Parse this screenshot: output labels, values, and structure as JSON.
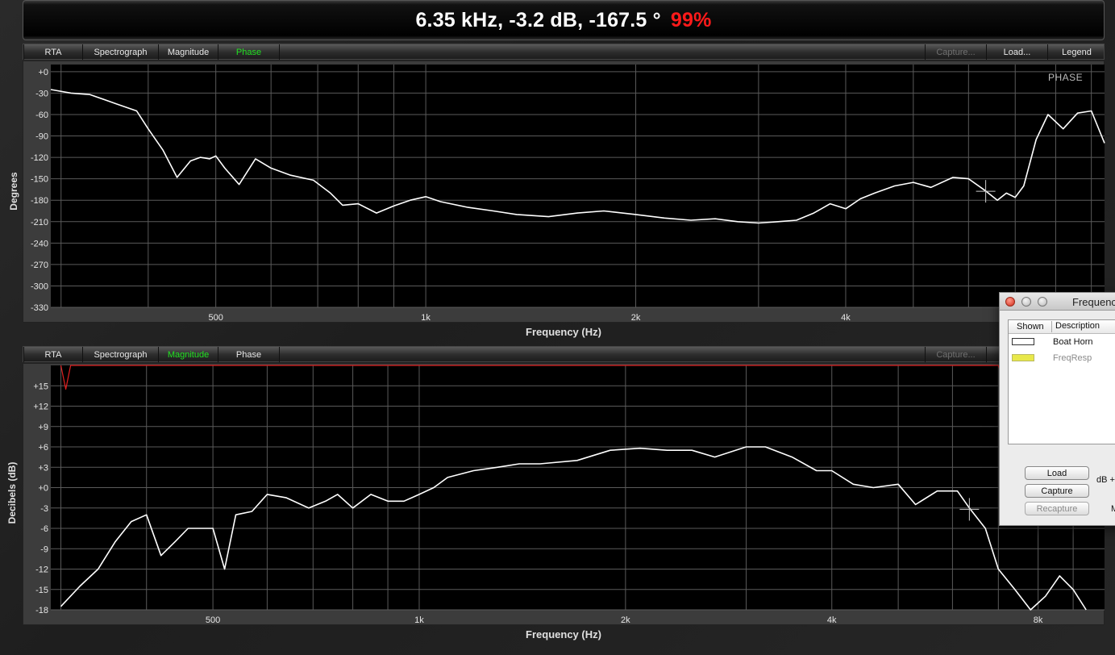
{
  "readout": {
    "text": "6.35 kHz, -3.2 dB, -167.5 °",
    "percent": "99%"
  },
  "tabs_left": [
    "RTA",
    "Spectrograph",
    "Magnitude",
    "Phase"
  ],
  "tabs_right": [
    "Capture...",
    "Load...",
    "Legend"
  ],
  "top_panel": {
    "active_tab": "Phase",
    "corner_label": "PHASE",
    "xlabel": "Frequency (Hz)",
    "ylabel": "Degrees"
  },
  "bottom_panel": {
    "active_tab": "Magnitude",
    "xlabel": "Frequency (Hz)",
    "ylabel": "Decibels (dB)"
  },
  "dialog": {
    "title": "Frequenc",
    "col_shown": "Shown",
    "col_description": "Description",
    "rows": [
      {
        "description": "Boat Horn",
        "swatch": "#ffffff",
        "dimmed": false
      },
      {
        "description": "FreqResp",
        "swatch": "#e8e84a",
        "dimmed": true
      }
    ],
    "load_label": "Load",
    "capture_label": "Capture",
    "recapture_label": "Recapture",
    "side_text_1": "dB +",
    "side_text_2": "M"
  },
  "colors": {
    "trace": "#ffffff",
    "reference": "#e02020",
    "active_tab": "#22e022",
    "percent": "#ff1a1a"
  },
  "chart_data": [
    {
      "type": "line",
      "title": "PHASE",
      "xlabel": "Frequency (Hz)",
      "ylabel": "Degrees",
      "xscale": "log",
      "xlim": [
        290,
        9400
      ],
      "ylim": [
        -330,
        10
      ],
      "x_ticks": [
        500,
        1000,
        2000,
        4000
      ],
      "x_tick_labels": [
        "500",
        "1k",
        "2k",
        "4k"
      ],
      "y_ticks": [
        0,
        -30,
        -60,
        -90,
        -120,
        -150,
        -180,
        -210,
        -240,
        -270,
        -300,
        -330
      ],
      "y_tick_labels": [
        "+0",
        "-30",
        "-60",
        "-90",
        "-120",
        "-150",
        "-180",
        "-210",
        "-240",
        "-270",
        "-300",
        "-330"
      ],
      "grid": true,
      "series": [
        {
          "x": [
            290,
            310,
            330,
            360,
            385,
            400,
            420,
            440,
            460,
            475,
            490,
            500,
            515,
            540,
            570,
            600,
            640,
            690,
            730,
            760,
            800,
            850,
            900,
            950,
            1000,
            1050,
            1150,
            1250,
            1350,
            1500,
            1650,
            1800,
            2000,
            2200,
            2400,
            2600,
            2800,
            3000,
            3200,
            3400,
            3600,
            3800,
            4000,
            4200,
            4400,
            4700,
            5000,
            5300,
            5700,
            6000,
            6350,
            6600,
            6800,
            7000,
            7200,
            7500,
            7800,
            8200,
            8600,
            9000,
            9400
          ],
          "y": [
            -25,
            -30,
            -32,
            -45,
            -55,
            -80,
            -110,
            -148,
            -125,
            -120,
            -122,
            -118,
            -135,
            -158,
            -122,
            -135,
            -145,
            -152,
            -170,
            -187,
            -185,
            -198,
            -188,
            -180,
            -175,
            -182,
            -190,
            -195,
            -200,
            -203,
            -198,
            -195,
            -200,
            -205,
            -208,
            -206,
            -210,
            -212,
            -210,
            -208,
            -198,
            -185,
            -192,
            -178,
            -170,
            -160,
            -155,
            -162,
            -148,
            -150,
            -167,
            -180,
            -170,
            -176,
            -160,
            -95,
            -60,
            -80,
            -58,
            -55,
            -100
          ]
        }
      ]
    },
    {
      "type": "line",
      "xlabel": "Frequency (Hz)",
      "ylabel": "Decibels (dB)",
      "xscale": "log",
      "xlim": [
        290,
        10000
      ],
      "ylim": [
        -18,
        18
      ],
      "x_ticks": [
        500,
        1000,
        2000,
        4000,
        8000
      ],
      "x_tick_labels": [
        "500",
        "1k",
        "2k",
        "4k",
        "8k"
      ],
      "y_ticks": [
        15,
        12,
        9,
        6,
        3,
        0,
        -3,
        -6,
        -9,
        -12,
        -15,
        -18
      ],
      "y_tick_labels": [
        "+15",
        "+12",
        "+9",
        "+6",
        "+3",
        "+0",
        "-3",
        "-6",
        "-9",
        "-12",
        "-15",
        "-18"
      ],
      "grid": true,
      "series": [
        {
          "x": [
            300,
            320,
            340,
            360,
            380,
            400,
            420,
            440,
            460,
            480,
            500,
            520,
            540,
            570,
            600,
            640,
            690,
            730,
            760,
            800,
            850,
            900,
            950,
            1000,
            1050,
            1100,
            1200,
            1300,
            1400,
            1500,
            1700,
            1900,
            2100,
            2300,
            2500,
            2700,
            3000,
            3200,
            3500,
            3800,
            4000,
            4300,
            4600,
            5000,
            5300,
            5700,
            6100,
            6350,
            6700,
            7000,
            7400,
            7800,
            8200,
            8600,
            9000,
            9400
          ],
          "y": [
            -17.5,
            -14.5,
            -12,
            -8,
            -5,
            -4,
            -10,
            -8,
            -6,
            -6,
            -6,
            -12,
            -4,
            -3.5,
            -1,
            -1.5,
            -3,
            -2,
            -1,
            -3,
            -1,
            -2,
            -2,
            -1,
            0,
            1.5,
            2.5,
            3,
            3.5,
            3.5,
            4,
            5.5,
            5.8,
            5.5,
            5.5,
            4.5,
            6,
            6,
            4.5,
            2.5,
            2.5,
            0.5,
            0,
            0.5,
            -2.5,
            -0.5,
            -0.5,
            -3,
            -6,
            -12,
            -15,
            -18,
            -16,
            -13,
            -15,
            -18
          ]
        },
        {
          "x": [
            300,
            305,
            310,
            500,
            1000,
            2000,
            4000,
            7000,
            7200,
            7400,
            9000
          ],
          "y": [
            18,
            14.5,
            18,
            18,
            18,
            18,
            18,
            18,
            14,
            18,
            18
          ]
        }
      ]
    }
  ]
}
